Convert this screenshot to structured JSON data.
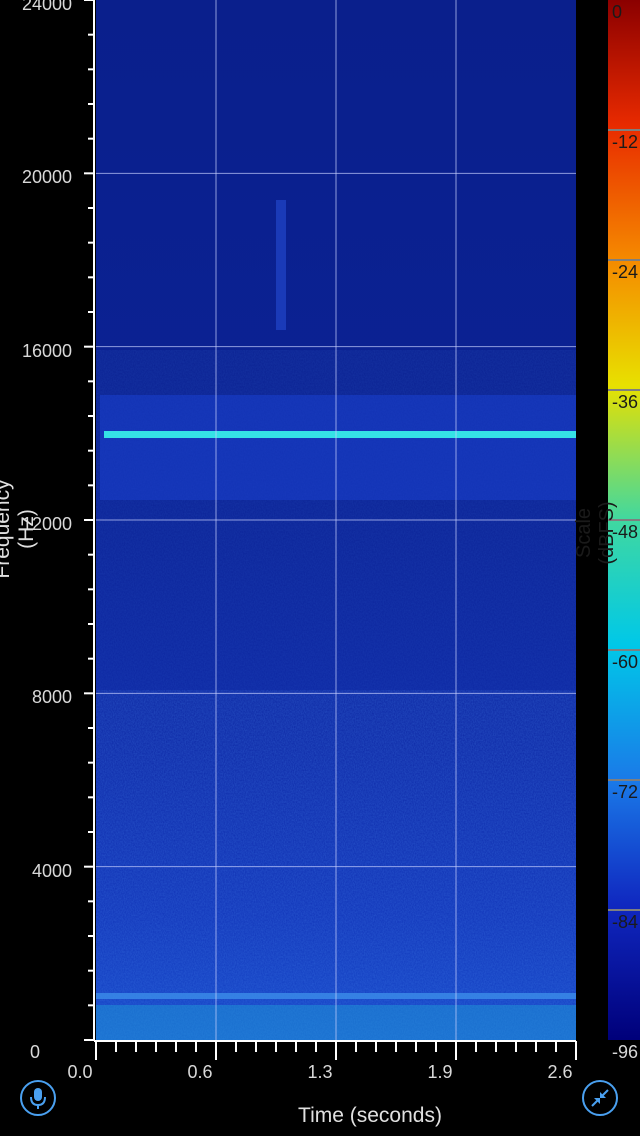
{
  "chart_data": {
    "type": "heatmap",
    "title": "",
    "xlabel": "Time (seconds)",
    "ylabel": "Frequency (Hz)",
    "xlim": [
      0.0,
      2.6
    ],
    "ylim": [
      0,
      24000
    ],
    "x_ticks": [
      "0.0",
      "0.6",
      "1.3",
      "1.9",
      "2.6"
    ],
    "y_ticks": [
      "0",
      "4000",
      "8000",
      "12000",
      "16000",
      "20000",
      "24000"
    ],
    "grid": true,
    "colorbar": {
      "label": "Scale (dBFS)",
      "range": [
        -96,
        0
      ],
      "ticks": [
        "0",
        "-12",
        "-24",
        "-36",
        "-48",
        "-60",
        "-72",
        "-84",
        "-96"
      ]
    },
    "features": [
      {
        "kind": "tone",
        "frequency_hz": 14000,
        "level_dbfs": -55
      },
      {
        "kind": "band",
        "from_hz": 12700,
        "to_hz": 15000,
        "level_dbfs": -80
      },
      {
        "kind": "tone",
        "frequency_hz": 1000,
        "level_dbfs": -70
      },
      {
        "kind": "noise",
        "from_hz": 0,
        "to_hz": 4000,
        "level_dbfs": -75
      }
    ]
  },
  "controls": {
    "mic_icon": "microphone-icon",
    "collapse_icon": "collapse-arrows-icon"
  }
}
